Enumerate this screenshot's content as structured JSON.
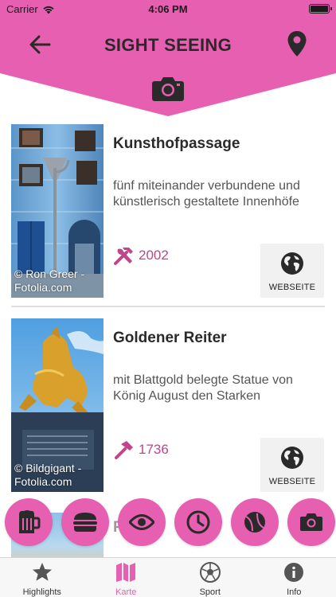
{
  "status_bar": {
    "carrier": "Carrier",
    "time": "4:06 PM"
  },
  "header": {
    "title": "SIGHT SEEING"
  },
  "colors": {
    "accent": "#e75fb0",
    "year_text": "#c0458a",
    "tab_inactive": "#555555"
  },
  "cards": [
    {
      "name": "Kunsthofpassage",
      "description": "fünf miteinander verbundene und künstlerisch gestaltete Innenhöfe",
      "year": "2002",
      "year_icon": "hammer-wrench-icon",
      "credit": "© Ron Greer - Fotolia.com",
      "website_label": "WEBSEITE"
    },
    {
      "name": "Goldener Reiter",
      "description": "mit Blattgold belegte Statue von König August den Starken",
      "year": "1736",
      "year_icon": "hammer-icon",
      "credit": "© Bildgigant - Fotolia.com",
      "website_label": "WEBSEITE"
    },
    {
      "name": "Pr..."
    }
  ],
  "filter_buttons": [
    {
      "icon": "beer-mug-icon"
    },
    {
      "icon": "burger-icon"
    },
    {
      "icon": "eye-icon"
    },
    {
      "icon": "clock-icon"
    },
    {
      "icon": "ball-icon"
    },
    {
      "icon": "camera-icon"
    }
  ],
  "tabs": [
    {
      "label": "Highlights",
      "icon": "star-icon",
      "active": false
    },
    {
      "label": "Karte",
      "icon": "map-icon",
      "active": true
    },
    {
      "label": "Sport",
      "icon": "soccer-ball-icon",
      "active": false
    },
    {
      "label": "Info",
      "icon": "info-icon",
      "active": false
    }
  ]
}
